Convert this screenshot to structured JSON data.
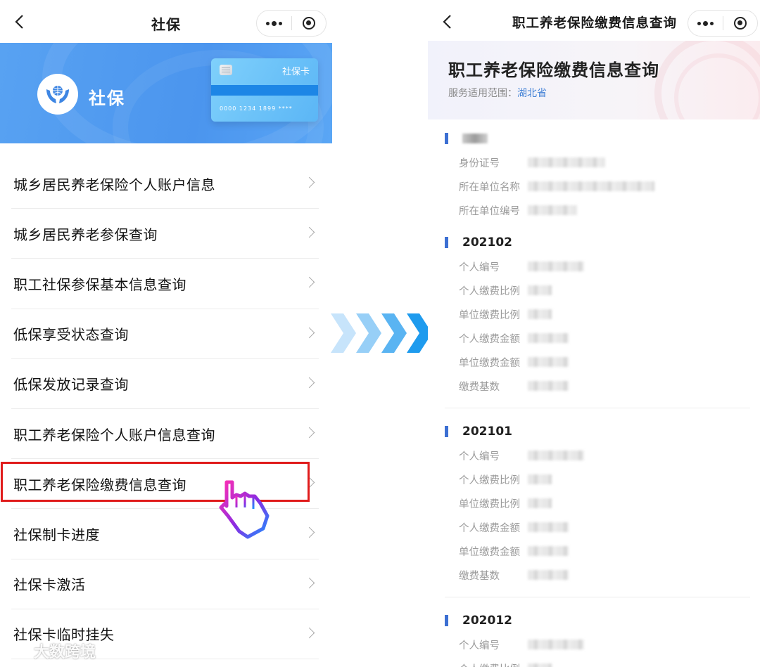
{
  "left": {
    "nav": {
      "title": "社保"
    },
    "banner": {
      "title": "社保",
      "card_label": "社保卡",
      "card_number": "0000  1234  1899  ****"
    },
    "menu": [
      {
        "label": "城乡居民养老保险个人账户信息"
      },
      {
        "label": "城乡居民养老参保查询"
      },
      {
        "label": "职工社保参保基本信息查询"
      },
      {
        "label": "低保享受状态查询"
      },
      {
        "label": "低保发放记录查询"
      },
      {
        "label": "职工养老保险个人账户信息查询"
      },
      {
        "label": "职工养老保险缴费信息查询"
      },
      {
        "label": "社保制卡进度"
      },
      {
        "label": "社保卡激活"
      },
      {
        "label": "社保卡临时挂失"
      }
    ],
    "highlighted_item": "职工养老保险缴费信息查询"
  },
  "right": {
    "nav": {
      "title": "职工养老保险缴费信息查询"
    },
    "header": {
      "title": "职工养老保险缴费信息查询",
      "scope_label": "服务适用范围：",
      "scope_value": "湖北省"
    },
    "profile": {
      "fields": [
        "身份证号",
        "所在单位名称",
        "所在单位编号"
      ]
    },
    "periods": [
      {
        "period": "202102",
        "fields": [
          "个人编号",
          "个人缴费比例",
          "单位缴费比例",
          "个人缴费金额",
          "单位缴费金额",
          "缴费基数"
        ]
      },
      {
        "period": "202101",
        "fields": [
          "个人编号",
          "个人缴费比例",
          "单位缴费比例",
          "个人缴费金额",
          "单位缴费金额",
          "缴费基数"
        ]
      },
      {
        "period": "202012",
        "fields": [
          "个人编号",
          "个人缴费比例"
        ]
      }
    ]
  },
  "watermark": "大数跨境",
  "colors": {
    "banner_blue": "#4b95ee",
    "highlight_red": "#e01b1b",
    "accent_blue": "#3c6fd2",
    "link_blue": "#3f7fd5"
  }
}
